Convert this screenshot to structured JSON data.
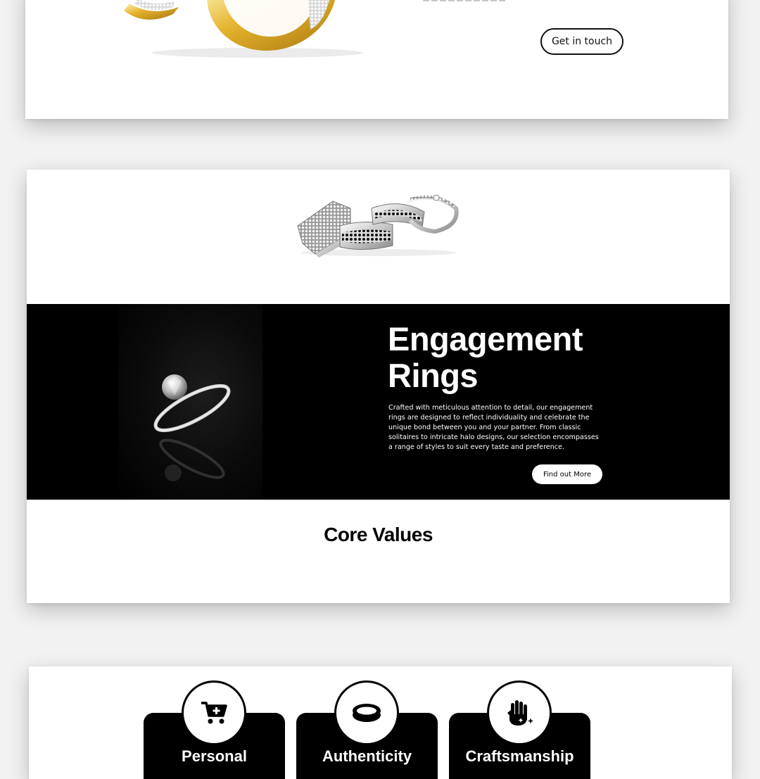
{
  "hero": {
    "get_in_touch_label": "Get in touch"
  },
  "engagement": {
    "title": "Engagement Rings",
    "description": "Crafted with meticulous attention to detail, our engagement rings are designed to reflect individuality and celebrate the unique bond between you and your partner. From classic solitaires to intricate halo designs, our selection encompasses a range of styles to suit every taste and preference.",
    "cta_label": "Find out More"
  },
  "core_values": {
    "title": "Core Values",
    "items": [
      {
        "label": "Personal",
        "icon": "shopping-cart-icon"
      },
      {
        "label": "Authenticity",
        "icon": "ring-icon"
      },
      {
        "label": "Craftsmanship",
        "icon": "sparkle-hand-icon"
      }
    ]
  },
  "colors": {
    "background": "#f2f2f2",
    "card": "#ffffff",
    "accent_dark": "#000000",
    "gold": "#e0b12e"
  }
}
